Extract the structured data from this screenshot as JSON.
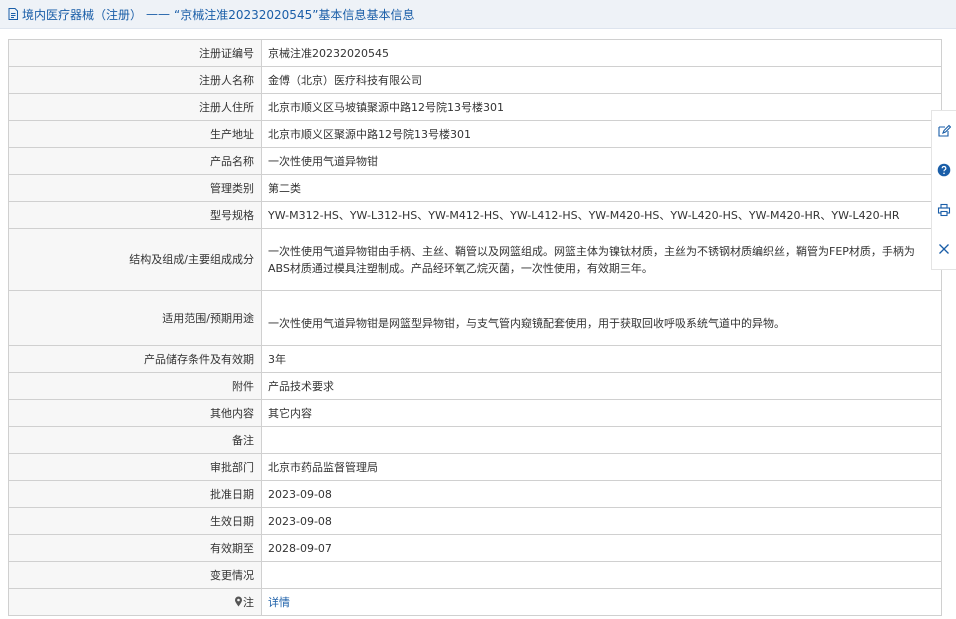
{
  "header": {
    "category": "境内医疗器械（注册）",
    "separator": "——",
    "title": "“京械注准20232020545”基本信息"
  },
  "rows": [
    {
      "label": "注册证编号",
      "value": "京械注准20232020545"
    },
    {
      "label": "注册人名称",
      "value": "金傅（北京）医疗科技有限公司"
    },
    {
      "label": "注册人住所",
      "value": "北京市顺义区马坡镇聚源中路12号院13号楼301"
    },
    {
      "label": "生产地址",
      "value": "北京市顺义区聚源中路12号院13号楼301"
    },
    {
      "label": "产品名称",
      "value": "一次性使用气道异物钳"
    },
    {
      "label": "管理类别",
      "value": "第二类"
    },
    {
      "label": "型号规格",
      "value": "YW-M312-HS、YW-L312-HS、YW-M412-HS、YW-L412-HS、YW-M420-HS、YW-L420-HS、YW-M420-HR、YW-L420-HR"
    },
    {
      "label": "结构及组成/主要组成成分",
      "value": "一次性使用气道异物钳由手柄、主丝、鞘管以及网篮组成。网篮主体为镍钛材质，主丝为不锈钢材质编织丝，鞘管为FEP材质，手柄为ABS材质通过模具注塑制成。产品经环氧乙烷灭菌，一次性使用，有效期三年。"
    },
    {
      "label": "适用范围/预期用途",
      "value": "一次性使用气道异物钳是网篮型异物钳，与支气管内窥镜配套使用，用于获取回收呼吸系统气道中的异物。"
    },
    {
      "label": "产品储存条件及有效期",
      "value": "3年"
    },
    {
      "label": "附件",
      "value": "产品技术要求"
    },
    {
      "label": "其他内容",
      "value": "其它内容"
    },
    {
      "label": "备注",
      "value": ""
    },
    {
      "label": "审批部门",
      "value": "北京市药品监督管理局"
    },
    {
      "label": "批准日期",
      "value": "2023-09-08"
    },
    {
      "label": "生效日期",
      "value": "2023-09-08"
    },
    {
      "label": "有效期至",
      "value": "2028-09-07"
    },
    {
      "label": "变更情况",
      "value": ""
    },
    {
      "label": "注",
      "value": "详情"
    }
  ],
  "toolbar": {
    "icons": [
      "edit-icon",
      "help-icon",
      "print-icon",
      "close-icon"
    ]
  },
  "colors": {
    "link": "#1a5ea8",
    "header_bg": "#eef2f7",
    "label_bg": "#f7f7f7",
    "border": "#d0d0d0"
  }
}
